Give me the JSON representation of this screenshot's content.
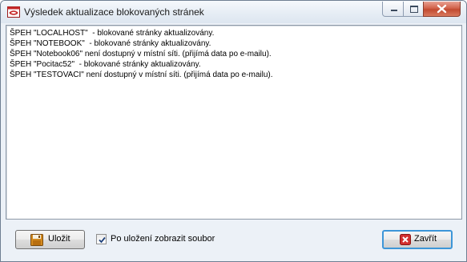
{
  "window": {
    "title": "Výsledek aktualizace blokovaných stránek",
    "icon": "app-icon"
  },
  "log": {
    "lines": [
      "ŠPEH \"LOCALHOST\"  - blokované stránky aktualizovány.",
      "ŠPEH \"NOTEBOOK\"  - blokované stránky aktualizovány.",
      "ŠPEH \"Notebook06\" není dostupný v místní síti. (přijímá data po e-mailu).",
      "ŠPEH \"Pocitac52\"  - blokované stránky aktualizovány.",
      "ŠPEH \"TESTOVACI\" není dostupný v místní síti. (přijímá data po e-mailu)."
    ]
  },
  "footer": {
    "save_label": "Uložit",
    "save_icon": "floppy-disk-icon",
    "checkbox_label": "Po uložení zobrazit soubor",
    "checkbox_checked": true,
    "close_label": "Zavřít",
    "close_icon": "red-x-icon"
  },
  "colors": {
    "accent_focus": "#3d96d8",
    "close_caption": "#c24a30"
  }
}
